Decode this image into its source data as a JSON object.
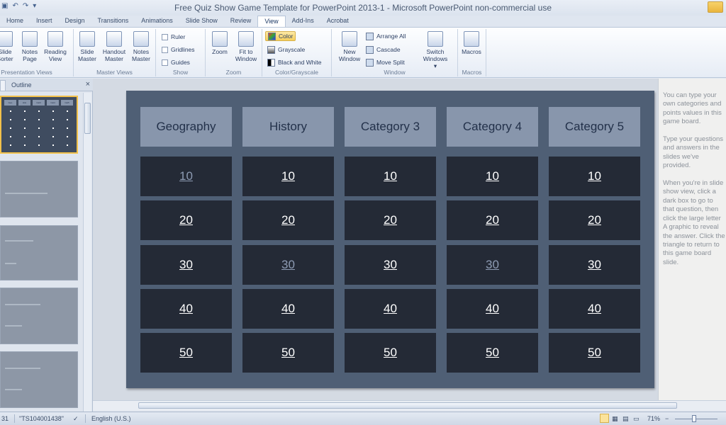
{
  "window": {
    "title": "Free Quiz Show Game Template for PowerPoint 2013-1  -  Microsoft PowerPoint non-commercial use",
    "qat_icons": [
      "save-icon",
      "undo-icon",
      "redo-icon"
    ]
  },
  "ribbon_tabs": [
    "Home",
    "Insert",
    "Design",
    "Transitions",
    "Animations",
    "Slide Show",
    "Review",
    "View",
    "Add-Ins",
    "Acrobat"
  ],
  "ribbon": {
    "presentation_views": {
      "label": "Presentation Views",
      "buttons": [
        "Slide\nSorter",
        "Notes\nPage",
        "Reading\nView"
      ]
    },
    "master_views": {
      "label": "Master Views",
      "buttons": [
        "Slide\nMaster",
        "Handout\nMaster",
        "Notes\nMaster"
      ]
    },
    "show": {
      "label": "Show",
      "items": [
        "Ruler",
        "Gridlines",
        "Guides"
      ]
    },
    "zoom": {
      "label": "Zoom",
      "buttons": [
        "Zoom",
        "Fit to\nWindow"
      ]
    },
    "color": {
      "label": "Color/Grayscale",
      "items": [
        "Color",
        "Grayscale",
        "Black and White"
      ]
    },
    "window": {
      "label": "Window",
      "new_window": "New\nWindow",
      "items": [
        "Arrange All",
        "Cascade",
        "Move Split"
      ],
      "switch": "Switch\nWindows ▾"
    },
    "macros": {
      "label": "Macros",
      "button": "Macros"
    }
  },
  "left_panel": {
    "tabs": [
      "",
      "Outline"
    ],
    "close": "×",
    "mini_headers": [
      "Geo",
      "Hist",
      "Cat3",
      "Cat4",
      "Cat5"
    ]
  },
  "slide": {
    "categories": [
      "Geography",
      "History",
      "Category 3",
      "Category 4",
      "Category 5"
    ],
    "values": [
      "10",
      "20",
      "30",
      "40",
      "50"
    ],
    "visited": [
      [
        0,
        0
      ],
      [
        1,
        2
      ],
      [
        3,
        2
      ]
    ]
  },
  "notes_text": "You can type your own categories and points values in this game board.\n\nType your questions and answers in the slides we've provided.\n\nWhen you're in slide show view, click a dark box to go to that question, then click the large letter A graphic to reveal the answer. Click the triangle to return to this game board slide.",
  "status": {
    "slide_num": "31",
    "theme": "\"TS104001438\"",
    "language": "English (U.S.)",
    "zoom": "71%",
    "zoom_minus": "−"
  }
}
